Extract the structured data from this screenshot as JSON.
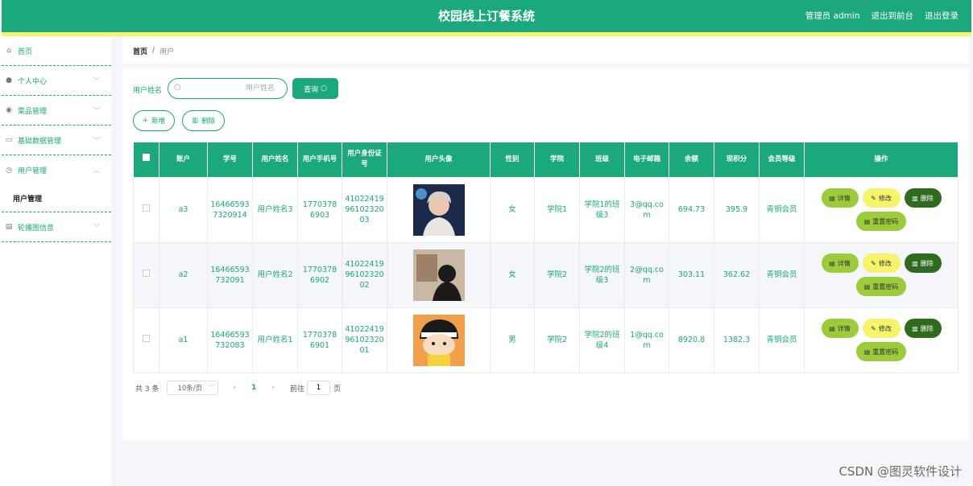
{
  "header": {
    "title": "校园线上订餐系统",
    "admin_label": "管理员 admin",
    "back_to_front": "退出到前台",
    "logout": "退出登录"
  },
  "sidebar": {
    "items": [
      {
        "label": "首页"
      },
      {
        "label": "个人中心"
      },
      {
        "label": "菜品管理"
      },
      {
        "label": "基础数据管理"
      },
      {
        "label": "用户管理"
      },
      {
        "label": "轮播图信息"
      }
    ],
    "sub_item": "用户管理"
  },
  "breadcrumb": {
    "home": "首页",
    "separator": "/",
    "current": "用户"
  },
  "search": {
    "label": "用户姓名",
    "placeholder": "用户姓名",
    "button": "查询"
  },
  "actions": {
    "add": "新增",
    "delete": "删除"
  },
  "table": {
    "headers": [
      "账户",
      "学号",
      "用户姓名",
      "用户手机号",
      "用户身份证号",
      "用户头像",
      "性别",
      "学院",
      "班级",
      "电子邮箱",
      "余额",
      "现积分",
      "会员等级",
      "操作"
    ],
    "rows": [
      {
        "account": "a3",
        "student_no": "164665937320914",
        "name": "用户姓名3",
        "phone": "17703786903",
        "id_card": "410224199610232003",
        "gender": "女",
        "college": "学院1",
        "class_name": "学院1的班级3",
        "email": "3@qq.com",
        "balance": "694.73",
        "points": "395.9",
        "level": "青铜会员"
      },
      {
        "account": "a2",
        "student_no": "16466593732091",
        "name": "用户姓名2",
        "phone": "17703786902",
        "id_card": "410224199610232002",
        "gender": "女",
        "college": "学院2",
        "class_name": "学院2的班级3",
        "email": "2@qq.com",
        "balance": "303.11",
        "points": "362.62",
        "level": "青铜会员"
      },
      {
        "account": "a1",
        "student_no": "16466593732083",
        "name": "用户姓名1",
        "phone": "17703786901",
        "id_card": "410224199610232001",
        "gender": "男",
        "college": "学院2",
        "class_name": "学院2的班级4",
        "email": "1@qq.com",
        "balance": "8920.8",
        "points": "1382.3",
        "level": "青铜会员"
      }
    ],
    "op_labels": {
      "detail": "详情",
      "edit": "修改",
      "delete": "删除",
      "reset": "重置密码"
    }
  },
  "pagination": {
    "total": "共 3 条",
    "page_size": "10条/页",
    "current_page": "1",
    "goto_label": "前往",
    "goto_value": "1",
    "page_unit": "页"
  },
  "watermark": "CSDN @图灵软件设计",
  "colors": {
    "primary": "#1aa87c",
    "highlight": "#f5f46a",
    "detail_btn": "#9ccc3c",
    "delete_btn": "#2e6b1f"
  }
}
